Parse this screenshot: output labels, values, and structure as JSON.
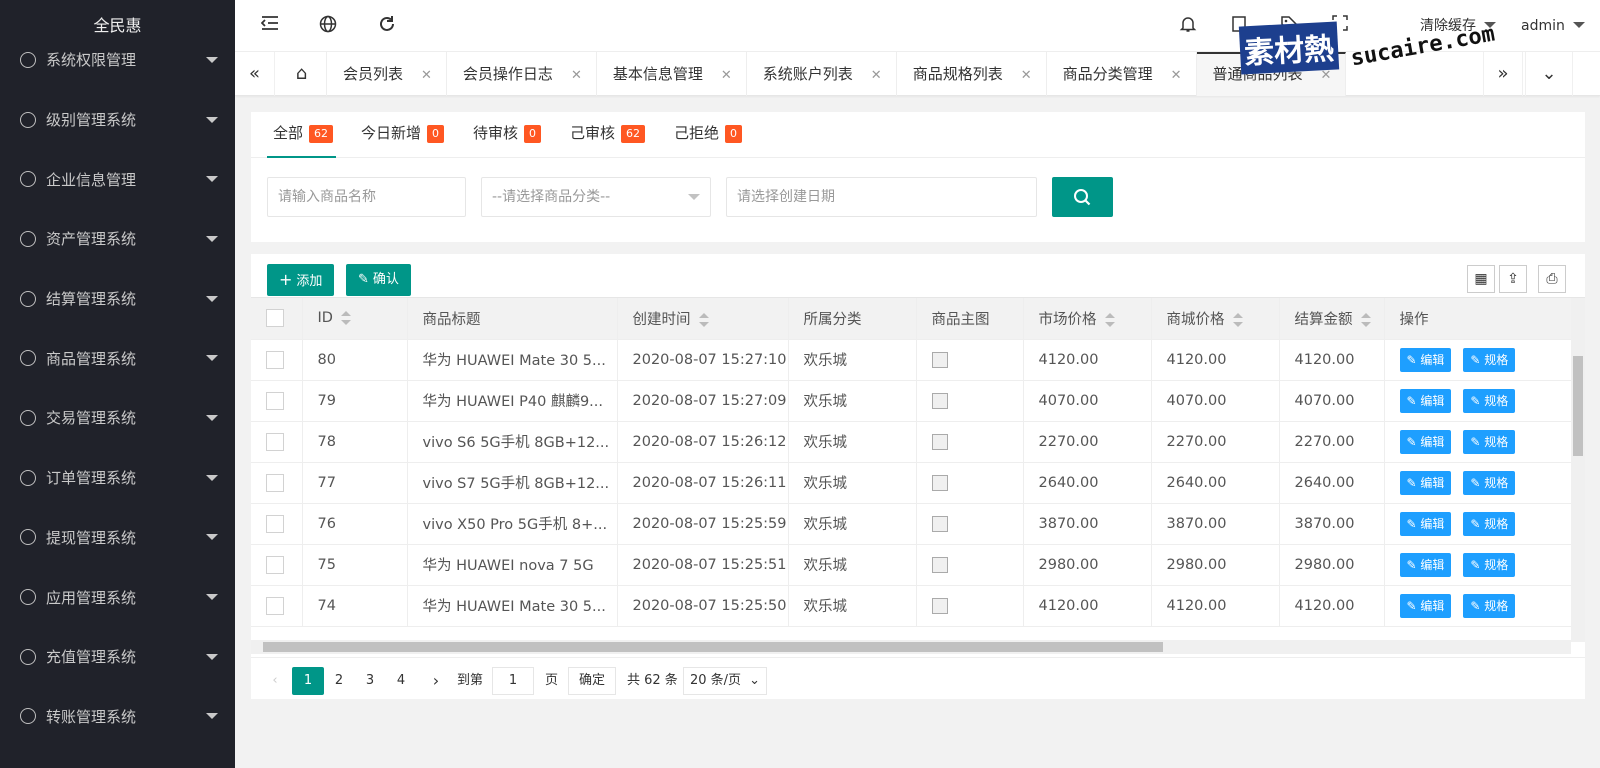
{
  "app": {
    "logo": "全民惠"
  },
  "sidebar": {
    "items": [
      {
        "label": "系统权限管理",
        "icon": "shield-icon"
      },
      {
        "label": "级别管理系统",
        "icon": "diamond-icon"
      },
      {
        "label": "企业信息管理",
        "icon": "edit-doc-icon"
      },
      {
        "label": "资产管理系统",
        "icon": "yen-icon"
      },
      {
        "label": "结算管理系统",
        "icon": "smile-icon"
      },
      {
        "label": "商品管理系统",
        "icon": "cart-icon"
      },
      {
        "label": "交易管理系统",
        "icon": "link-icon"
      },
      {
        "label": "订单管理系统",
        "icon": "location-icon"
      },
      {
        "label": "提现管理系统",
        "icon": "yen-icon"
      },
      {
        "label": "应用管理系统",
        "icon": "apps-icon"
      },
      {
        "label": "充值管理系统",
        "icon": "yen-icon"
      },
      {
        "label": "转账管理系统",
        "icon": "link-icon"
      }
    ]
  },
  "topbar": {
    "clear_cache": "清除缓存",
    "user": "admin"
  },
  "tabs": [
    {
      "label": "会员列表"
    },
    {
      "label": "会员操作日志"
    },
    {
      "label": "基本信息管理"
    },
    {
      "label": "系统账户列表"
    },
    {
      "label": "商品规格列表"
    },
    {
      "label": "商品分类管理"
    },
    {
      "label": "普通商品列表"
    }
  ],
  "watermark": {
    "cn": "素材熱",
    "en": "sucaire.com"
  },
  "filters": [
    {
      "label": "全部",
      "count": "62"
    },
    {
      "label": "今日新增",
      "count": "0"
    },
    {
      "label": "待审核",
      "count": "0"
    },
    {
      "label": "己审核",
      "count": "62"
    },
    {
      "label": "己拒绝",
      "count": "0"
    }
  ],
  "search": {
    "name_placeholder": "请输入商品名称",
    "category_placeholder": "--请选择商品分类--",
    "date_placeholder": "请选择创建日期"
  },
  "toolbar": {
    "add": "添加",
    "confirm": "确认"
  },
  "table": {
    "headers": [
      "ID",
      "商品标题",
      "创建时间",
      "所属分类",
      "商品主图",
      "市场价格",
      "商城价格",
      "结算金额",
      "操作"
    ],
    "edit": "编辑",
    "spec": "规格",
    "rows": [
      {
        "id": "80",
        "title": "华为 HUAWEI Mate 30 5...",
        "time": "2020-08-07 15:27:10",
        "cat": "欢乐城",
        "market": "4120.00",
        "mall": "4120.00",
        "settle": "4120.00"
      },
      {
        "id": "79",
        "title": "华为 HUAWEI P40 麒麟9...",
        "time": "2020-08-07 15:27:09",
        "cat": "欢乐城",
        "market": "4070.00",
        "mall": "4070.00",
        "settle": "4070.00"
      },
      {
        "id": "78",
        "title": "vivo S6 5G手机 8GB+12...",
        "time": "2020-08-07 15:26:12",
        "cat": "欢乐城",
        "market": "2270.00",
        "mall": "2270.00",
        "settle": "2270.00"
      },
      {
        "id": "77",
        "title": "vivo S7 5G手机 8GB+12...",
        "time": "2020-08-07 15:26:11",
        "cat": "欢乐城",
        "market": "2640.00",
        "mall": "2640.00",
        "settle": "2640.00"
      },
      {
        "id": "76",
        "title": "vivo X50 Pro 5G手机 8+...",
        "time": "2020-08-07 15:25:59",
        "cat": "欢乐城",
        "market": "3870.00",
        "mall": "3870.00",
        "settle": "3870.00"
      },
      {
        "id": "75",
        "title": "华为 HUAWEI nova 7 5G",
        "time": "2020-08-07 15:25:51",
        "cat": "欢乐城",
        "market": "2980.00",
        "mall": "2980.00",
        "settle": "2980.00"
      },
      {
        "id": "74",
        "title": "华为 HUAWEI Mate 30 5...",
        "time": "2020-08-07 15:25:50",
        "cat": "欢乐城",
        "market": "4120.00",
        "mall": "4120.00",
        "settle": "4120.00"
      }
    ]
  },
  "pager": {
    "pages": [
      "1",
      "2",
      "3",
      "4"
    ],
    "goto": "到第",
    "goto_value": "1",
    "page_unit": "页",
    "ok": "确定",
    "total": "共 62 条",
    "per_page": "20 条/页"
  }
}
